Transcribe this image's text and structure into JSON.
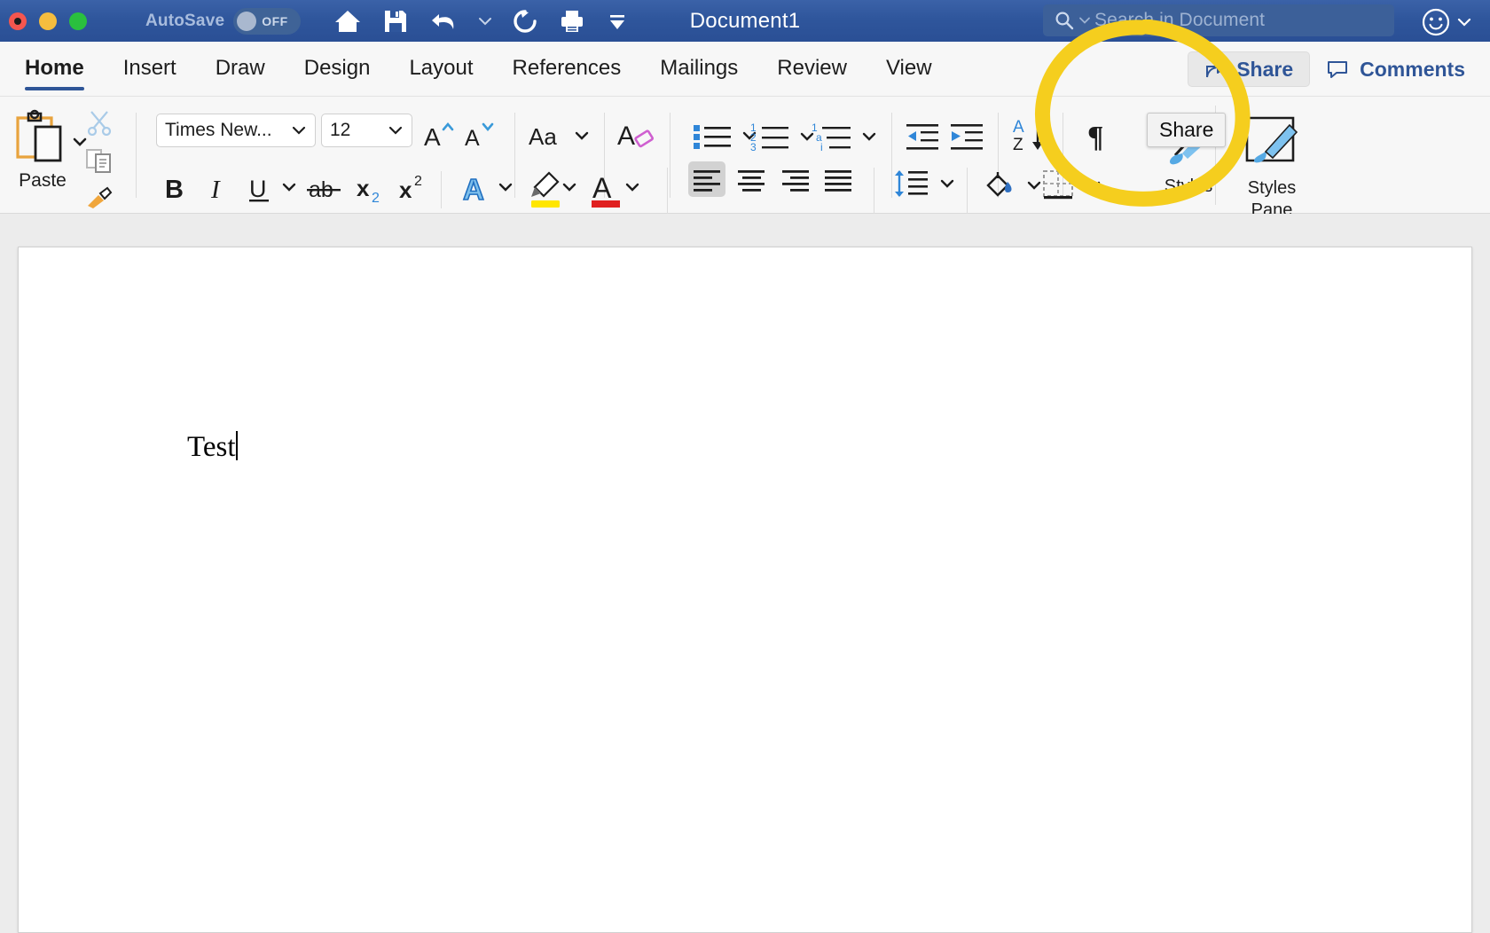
{
  "titlebar": {
    "window_controls": [
      "close",
      "minimize",
      "maximize"
    ],
    "autosave_label": "AutoSave",
    "autosave_state": "OFF",
    "document_title": "Document1",
    "quick_access": [
      {
        "name": "home-icon",
        "label": "Home"
      },
      {
        "name": "save-icon",
        "label": "Save"
      },
      {
        "name": "undo-icon",
        "label": "Undo"
      },
      {
        "name": "undo-dropdown-icon",
        "label": "Undo options"
      },
      {
        "name": "redo-icon",
        "label": "Redo"
      },
      {
        "name": "print-icon",
        "label": "Print"
      },
      {
        "name": "customize-toolbar-icon",
        "label": "Customize Quick Access Toolbar"
      }
    ],
    "search_placeholder": "Search in Document",
    "account_icon": "smiley-face-icon",
    "background_color": "#2f569c"
  },
  "ribbon_tabs": {
    "items": [
      {
        "label": "Home",
        "active": true
      },
      {
        "label": "Insert",
        "active": false
      },
      {
        "label": "Draw",
        "active": false
      },
      {
        "label": "Design",
        "active": false
      },
      {
        "label": "Layout",
        "active": false
      },
      {
        "label": "References",
        "active": false
      },
      {
        "label": "Mailings",
        "active": false
      },
      {
        "label": "Review",
        "active": false
      },
      {
        "label": "View",
        "active": false
      }
    ],
    "share_label": "Share",
    "comments_label": "Comments",
    "active_underline_color": "#2f5597",
    "link_color": "#2f5597"
  },
  "ribbon": {
    "clipboard": {
      "paste_label": "Paste",
      "cut_label": "Cut",
      "copy_label": "Copy",
      "format_painter_label": "Format Painter"
    },
    "font": {
      "font_name": "Times New...",
      "font_size": "12",
      "grow_font_label": "Grow Font",
      "shrink_font_label": "Shrink Font",
      "change_case_label": "Aa",
      "clear_formatting_label": "Clear Formatting",
      "bold_label": "B",
      "italic_label": "I",
      "underline_label": "U",
      "strikethrough_label": "ab",
      "subscript_label": "x₂",
      "superscript_label": "x²",
      "text_effects_label": "A",
      "highlight_label": "Text Highlight Color",
      "font_color_label": "Font Color",
      "highlight_color": "#ffe600",
      "font_color": "#e02020"
    },
    "paragraph": {
      "bullets_label": "Bullets",
      "numbering_label": "Numbering",
      "multilevel_label": "Multilevel List",
      "decrease_indent_label": "Decrease Indent",
      "increase_indent_label": "Increase Indent",
      "sort_label": "Sort",
      "show_marks_label": "¶",
      "align_left_label": "Align Left",
      "align_center_label": "Center",
      "align_right_label": "Align Right",
      "justify_label": "Justify",
      "line_spacing_label": "Line Spacing",
      "shading_label": "Shading",
      "borders_label": "Borders",
      "align_left_selected": true
    },
    "styles": {
      "styles_label": "Styles",
      "styles_pane_label": "Styles\nPane",
      "styles_pane_line1": "Styles",
      "styles_pane_line2": "Pane"
    }
  },
  "tooltip": {
    "text": "Share"
  },
  "annotation": {
    "shape": "hand-drawn-circle",
    "color": "#f5ce1e"
  },
  "document": {
    "body_text": "Test",
    "page_background": "#ffffff",
    "workspace_background": "#ececec"
  }
}
